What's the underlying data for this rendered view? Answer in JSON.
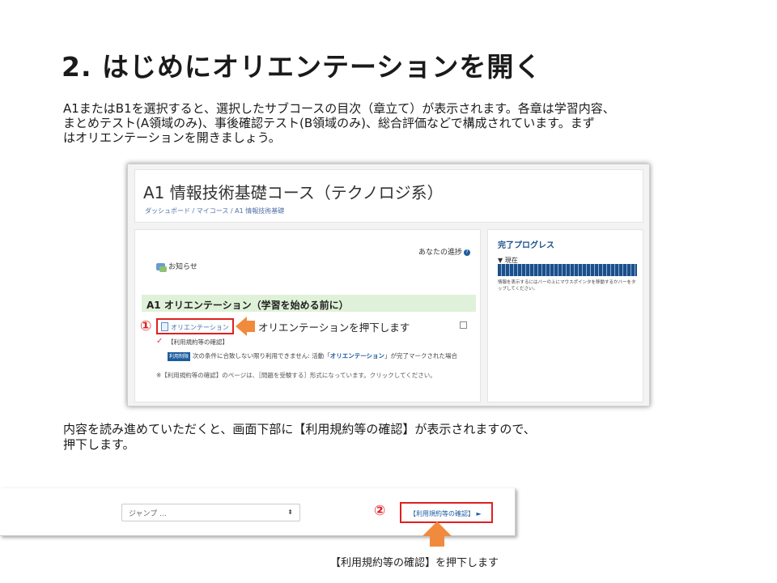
{
  "slide": {
    "title": "2. はじめにオリエンテーションを開く",
    "intro_lines": [
      "A1またはB1を選択すると、選択したサブコースの目次（章立て）が表示されます。各章は学習内容、",
      "まとめテスト(A領域のみ)、事後確認テスト(B領域のみ)、総合評価などで構成されています。まず",
      "はオリエンテーションを開きましょう。"
    ],
    "mid_lines": [
      "内容を読み進めていただくと、画面下部に【利用規約等の確認】が表示されますので、",
      "押下します。"
    ],
    "bottom_note": "【利用規約等の確認】を押下します"
  },
  "course_page": {
    "title": "A1 情報技術基礎コース（テクノロジ系）",
    "breadcrumb": "ダッシュボード / マイコース / A1 情報技術基礎",
    "progress_label": "あなたの進捗",
    "help_icon": "?",
    "news_label": "お知らせ",
    "section_title": "A1 オリエンテーション（学習を始める前に）",
    "marker1": "①",
    "activity_label": "オリエンテーション",
    "press_note": "オリエンテーションを押下します",
    "check_mark": "✓",
    "terms_label": "【利用規約等の確認】",
    "restrict_badge": "利用制限",
    "restrict_pre": "次の条件に合致しない限り利用できません: 活動「",
    "restrict_activity": "オリエンテーション",
    "restrict_post": "」が完了マークされた場合",
    "note": "※【利用規約等の確認】のページは、［問題を受験する］形式になっています。クリックしてください。",
    "side_title": "完了プログレス",
    "side_current": "▼ 現在",
    "side_help": "情報を表示するにはバーの上にマウスポインタを移動するかバーをタップしてください。"
  },
  "nav_bar": {
    "jump_label": "ジャンプ ...",
    "jump_caret": "⬍",
    "marker2": "②",
    "next_label": "【利用規約等の確認】 ►"
  },
  "colors": {
    "accent_red": "#e02020",
    "arrow_orange": "#f08a3c",
    "section_green": "#dff1d8",
    "link_blue": "#1b5c9e"
  }
}
